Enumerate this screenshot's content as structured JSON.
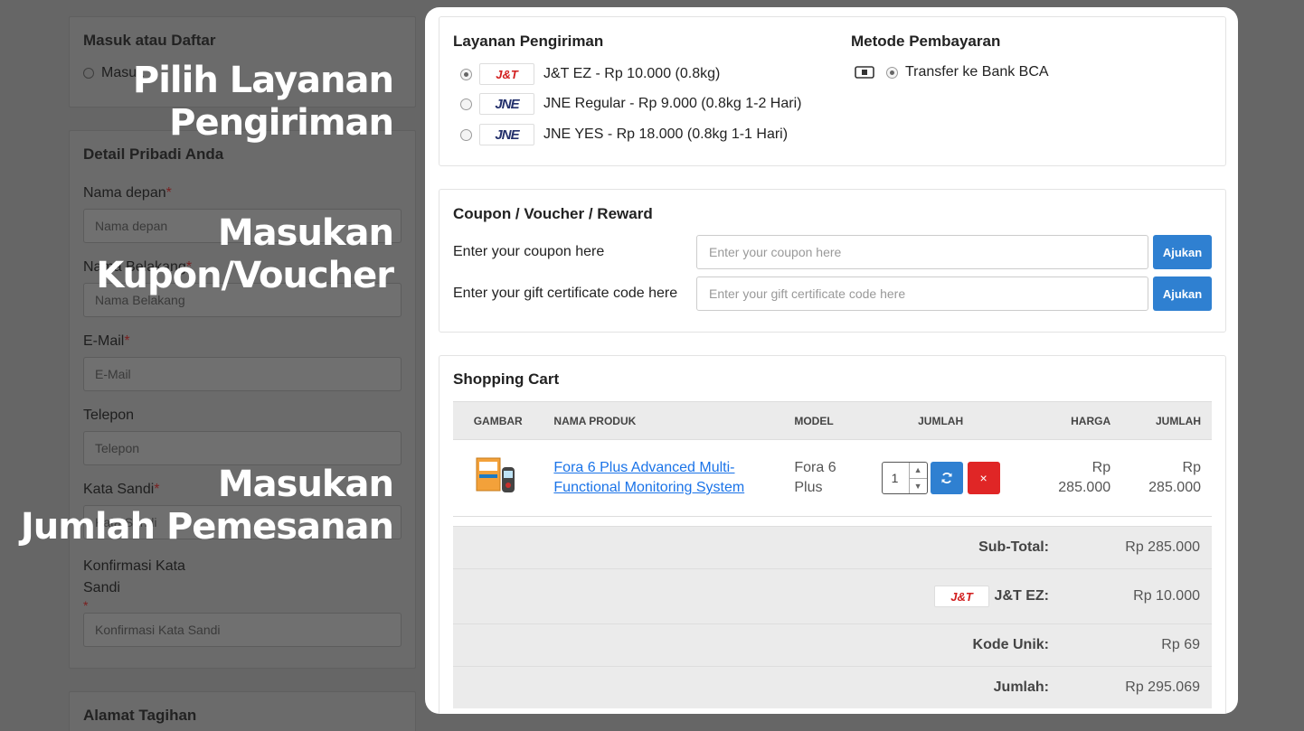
{
  "overlay": {
    "line1a": "Pilih Layanan",
    "line1b": "Pengiriman",
    "line2a": "Masukan",
    "line2b": "Kupon/Voucher",
    "line3a": "Masukan",
    "line3b": "Jumlah Pemesanan"
  },
  "left": {
    "login_title": "Masuk atau Daftar",
    "login_option": "Masuk",
    "personal_title": "Detail Pribadi Anda",
    "first_name_label": "Nama depan",
    "first_name_placeholder": "Nama depan",
    "last_name_label": "Nama Belakang",
    "last_name_placeholder": "Nama Belakang",
    "email_label": "E-Mail",
    "email_placeholder": "E-Mail",
    "phone_label": "Telepon",
    "phone_placeholder": "Telepon",
    "password_label": "Kata Sandi",
    "password_placeholder": "Kata Sandi",
    "confirm_label_1": "Konfirmasi Kata",
    "confirm_label_2": "Sandi",
    "confirm_placeholder": "Konfirmasi Kata Sandi",
    "required_mark": "*",
    "billing_title": "Alamat Tagihan"
  },
  "shipping": {
    "title": "Layanan Pengiriman",
    "options": [
      {
        "logo": "J&T",
        "label": "J&T EZ - Rp 10.000 (0.8kg)",
        "selected": true
      },
      {
        "logo": "JNE",
        "label": "JNE Regular - Rp 9.000 (0.8kg 1-2 Hari)",
        "selected": false
      },
      {
        "logo": "JNE",
        "label": "JNE YES - Rp 18.000 (0.8kg 1-1 Hari)",
        "selected": false
      }
    ]
  },
  "payment": {
    "title": "Metode Pembayaran",
    "option": "Transfer ke Bank BCA",
    "icon": "bank-transfer-icon"
  },
  "coupon": {
    "title": "Coupon / Voucher / Reward",
    "coupon_label": "Enter your coupon here",
    "coupon_placeholder": "Enter your coupon here",
    "gift_label": "Enter your gift certificate code here",
    "gift_placeholder": "Enter your gift certificate code here",
    "apply_label": "Ajukan"
  },
  "cart": {
    "title": "Shopping Cart",
    "headers": {
      "image": "GAMBAR",
      "name": "NAMA PRODUK",
      "model": "MODEL",
      "qty": "JUMLAH",
      "price": "HARGA",
      "total": "JUMLAH"
    },
    "item": {
      "name": "Fora 6 Plus Advanced Multi-Functional Monitoring System",
      "model": "Fora 6 Plus",
      "qty": "1",
      "price": "Rp 285.000",
      "total": "Rp 285.000"
    },
    "refresh_icon": "refresh-icon",
    "remove_icon": "×"
  },
  "totals": {
    "subtotal_label": "Sub-Total:",
    "subtotal_value": "Rp 285.000",
    "shipping_logo": "J&T",
    "shipping_label": "J&T EZ:",
    "shipping_value": "Rp 10.000",
    "unique_label": "Kode Unik:",
    "unique_value": "Rp 69",
    "total_label": "Jumlah:",
    "total_value": "Rp 295.069"
  },
  "colors": {
    "accent": "#2f80d1",
    "danger": "#e02626",
    "link": "#1a73e8"
  }
}
